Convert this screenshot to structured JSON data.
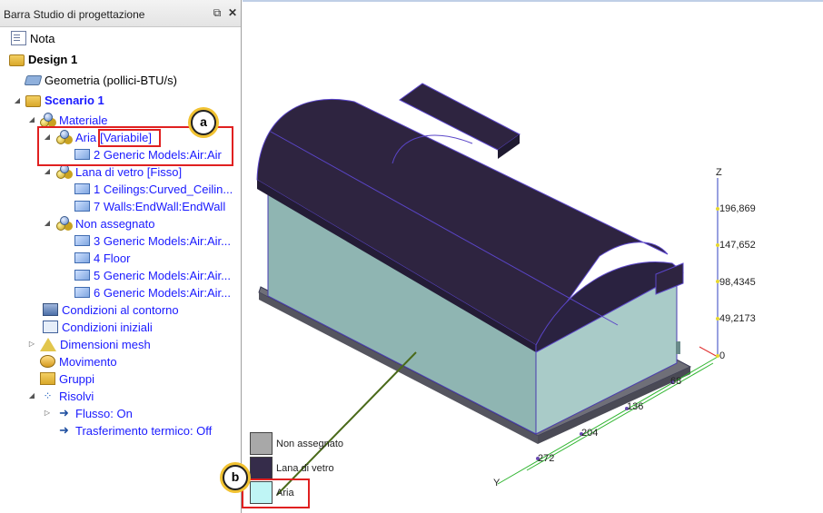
{
  "panel": {
    "title": "Barra Studio di progettazione",
    "pin_icon": "pin-icon",
    "close_icon": "close-icon"
  },
  "tree": {
    "note": "Nota",
    "design": "Design 1",
    "geometry": "Geometria (pollici-BTU/s)",
    "scenario": "Scenario 1",
    "materials": "Materiale",
    "air": "Aria",
    "air_tag": "[Variabile]",
    "air_child": "2 Generic Models:Air:Air",
    "glass": "Lana di vetro [Fisso]",
    "glass_children": [
      "1 Ceilings:Curved_Ceilin...",
      "7 Walls:EndWall:EndWall"
    ],
    "unassigned": "Non assegnato",
    "unassigned_children": [
      "3 Generic Models:Air:Air...",
      "4 Floor",
      "5 Generic Models:Air:Air...",
      "6 Generic Models:Air:Air..."
    ],
    "boundary": "Condizioni al contorno",
    "initial": "Condizioni iniziali",
    "mesh": "Dimensioni mesh",
    "motion": "Movimento",
    "groups": "Gruppi",
    "solve": "Risolvi",
    "flow": "Flusso: On",
    "heat": "Trasferimento termico: Off"
  },
  "callouts": {
    "a": "a",
    "b": "b"
  },
  "legend": [
    {
      "label": "Non assegnato",
      "color": "#a8a8a8"
    },
    {
      "label": "Lana di vetro",
      "color": "#352c4a"
    },
    {
      "label": "Aria",
      "color": "#bff5f5"
    }
  ],
  "axes": {
    "z_label": "Z",
    "y_label": "Y",
    "z_ticks": [
      "196,869",
      "147,652",
      "98,4345",
      "49,2173",
      "0"
    ],
    "x_ticks": [
      "68",
      "136",
      "204",
      "272"
    ]
  },
  "colors": {
    "roof": "#2e2440",
    "wall": "#8fb5b2",
    "wall_side": "#a9cbc8",
    "accent_line": "#5a45c8",
    "green_axis": "#2fb52f"
  }
}
